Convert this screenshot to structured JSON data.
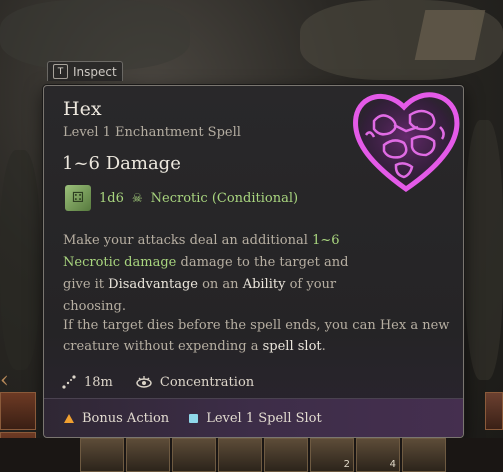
{
  "inspect": {
    "key": "T",
    "label": "Inspect"
  },
  "spell": {
    "name": "Hex",
    "subtitle": "Level 1 Enchantment Spell",
    "damage_heading": "1~6 Damage",
    "dice": {
      "formula": "1d6",
      "type": "Necrotic (Conditional)"
    },
    "description": {
      "p1_a": "Make your attacks deal an additional ",
      "p1_dmg": "1~6",
      "p1_type": "Necrotic damage",
      "p1_b": " damage to the target and give it ",
      "p1_dis": "Disadvantage",
      "p1_c": " on an ",
      "p1_ability": "Ability",
      "p1_d": " of your choosing.",
      "p2_a": "If the target dies before the spell ends, you can Hex a new creature without expending a ",
      "p2_slot": "spell slot",
      "p2_b": "."
    },
    "range": "18m",
    "concentration": "Concentration",
    "costs": {
      "action": "Bonus Action",
      "slot": "Level 1 Spell Slot"
    },
    "icon": "heart-hex-icon",
    "accent_color": "#d04ad8"
  },
  "hotbar": {
    "slot_counts": [
      "2",
      "4"
    ]
  }
}
